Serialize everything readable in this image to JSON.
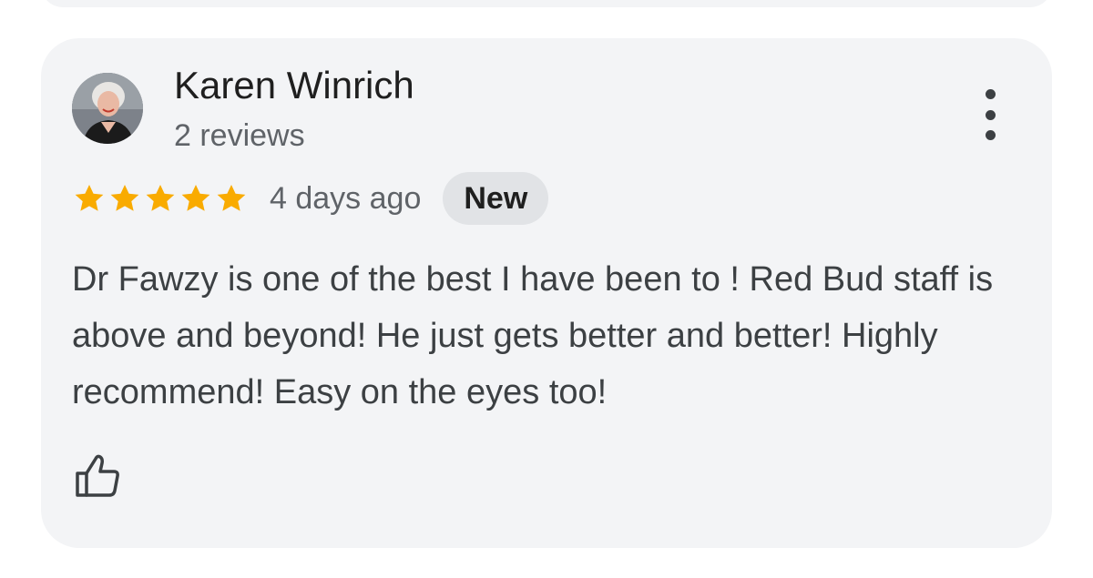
{
  "review": {
    "reviewer_name": "Karen Winrich",
    "review_count": "2 reviews",
    "rating": 5,
    "rating_max": 5,
    "date": "4 days ago",
    "badge": "New",
    "text": "Dr Fawzy is one of the best I have been to ! Red Bud staff is above and beyond! He just gets better and better! Highly recommend! Easy on the eyes too!"
  },
  "icons": {
    "more": "more-vert-icon",
    "like": "thumb-up-icon",
    "star": "star-icon"
  },
  "colors": {
    "card_background": "#f3f4f6",
    "star": "#f9ab00",
    "badge_background": "#e1e3e6"
  }
}
